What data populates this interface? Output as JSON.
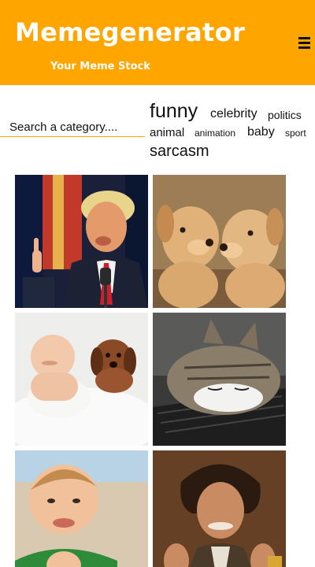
{
  "header": {
    "brand": "Memegenerator",
    "tagline": "Your Meme Stock",
    "menu_icon": "hamburger-menu-icon"
  },
  "search": {
    "placeholder": "Search a category...."
  },
  "tags": [
    {
      "label": "funny"
    },
    {
      "label": "celebrity"
    },
    {
      "label": "politics"
    },
    {
      "label": "animal"
    },
    {
      "label": "animation"
    },
    {
      "label": "baby"
    },
    {
      "label": "sport"
    },
    {
      "label": "sarcasm"
    }
  ],
  "colors": {
    "brand": "#ffa500",
    "text": "#111111",
    "background": "#ffffff"
  }
}
